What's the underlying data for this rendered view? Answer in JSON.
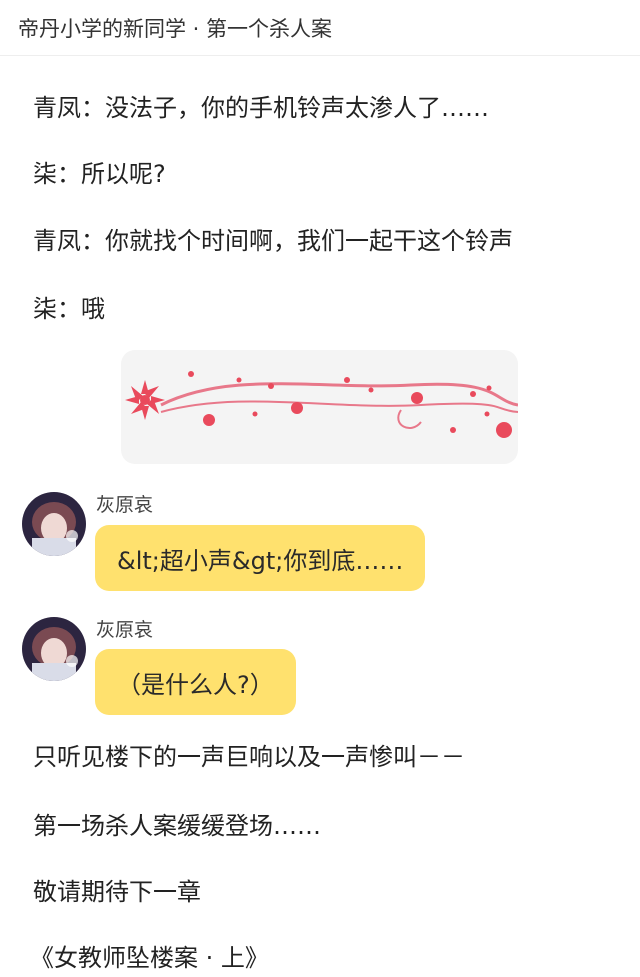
{
  "header": {
    "title": "帝丹小学的新同学 · 第一个杀人案"
  },
  "story": {
    "line1": "青凤：没法子，你的手机铃声太渗人了……",
    "line2": "柒：所以呢?",
    "line3": "青凤：你就找个时间啊，我们一起干这个铃声",
    "line4": "柒：哦",
    "line5": "只听见楼下的一声巨响以及一声惨叫－－",
    "line6": "第一场杀人案缓缓登场……",
    "line7": "敬请期待下一章",
    "line8": "《女教师坠楼案 · 上》"
  },
  "chat": [
    {
      "username": "灰原哀",
      "message": "&lt;超小声&gt;你到底……"
    },
    {
      "username": "灰原哀",
      "message": "（是什么人?）"
    }
  ],
  "colors": {
    "bubble": "#ffe16e",
    "divider_bg": "#f4f4f4",
    "petal": "#e94a5c"
  },
  "icons": {
    "divider": "cherry-blossom-divider-icon"
  }
}
